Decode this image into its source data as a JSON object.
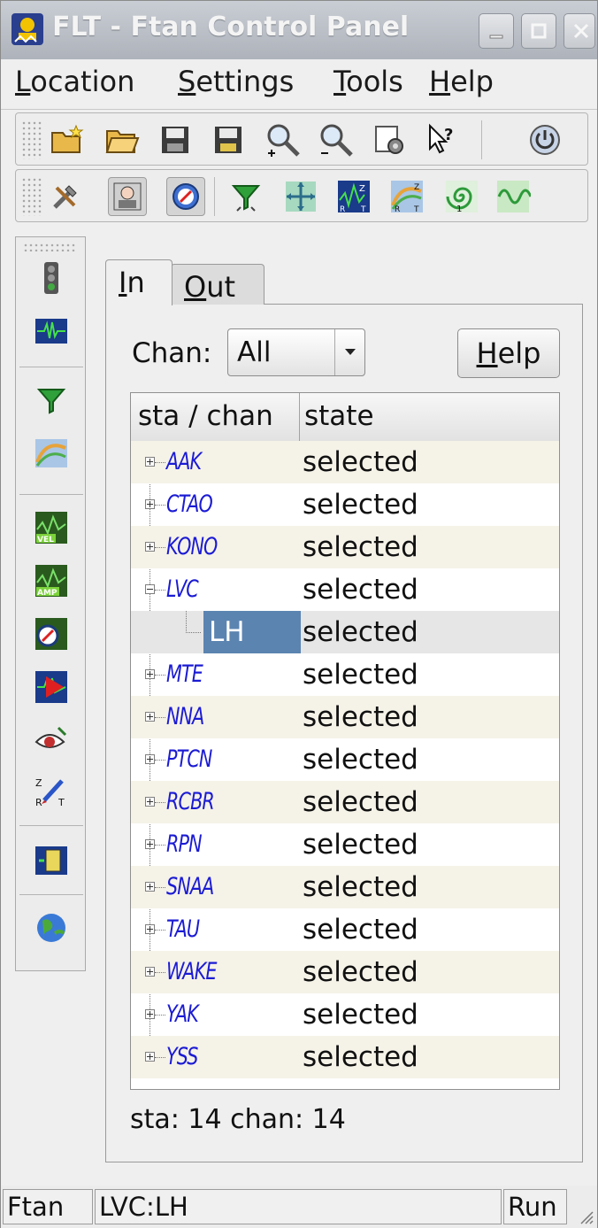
{
  "window": {
    "title": "FLT - Ftan Control Panel"
  },
  "menubar": {
    "items": [
      {
        "label": "Location",
        "mnemonic": "L"
      },
      {
        "label": "Settings",
        "mnemonic": "S"
      },
      {
        "label": "Tools",
        "mnemonic": "T"
      },
      {
        "label": "Help",
        "mnemonic": "H"
      }
    ]
  },
  "toolbar1": {
    "icons": [
      "new-folder-icon",
      "open-folder-icon",
      "save-icon",
      "save-as-icon",
      "zoom-in-icon",
      "zoom-out-icon",
      "settings-gear-icon",
      "whats-this-icon",
      "power-icon"
    ]
  },
  "toolbar2": {
    "icons": [
      "tools-icon",
      "operator-icon",
      "compass-icon",
      "filter-icon",
      "move-cross-icon",
      "seismogram-zrt-icon",
      "curve-rt-icon",
      "spiral-icon",
      "sine-wave-icon"
    ],
    "pressed": [
      "operator-icon",
      "compass-icon"
    ]
  },
  "sidebar": {
    "icons": [
      "traffic-light-icon",
      "waveform-icon",
      "filter-icon",
      "curve-icon",
      "velocity-icon",
      "amplitude-icon",
      "compass-icon",
      "phase-red-icon",
      "eye-icon",
      "zrt-pen-icon",
      "battery-icon",
      "globe-icon"
    ]
  },
  "tabs": [
    {
      "label": "In",
      "mnemonic": "I",
      "active": true
    },
    {
      "label": "Out",
      "mnemonic": "O",
      "active": false
    }
  ],
  "controls": {
    "chan_label": "Chan:",
    "chan_value": "All",
    "help_button": "Help"
  },
  "table": {
    "headers": [
      "sta / chan",
      "state"
    ],
    "rows": [
      {
        "sta": "AAK",
        "state": "selected",
        "expanded": false
      },
      {
        "sta": "CTAO",
        "state": "selected",
        "expanded": false
      },
      {
        "sta": "KONO",
        "state": "selected",
        "expanded": false
      },
      {
        "sta": "LVC",
        "state": "selected",
        "expanded": true
      },
      {
        "sta": "LH",
        "state": "selected",
        "child": true,
        "selected": true
      },
      {
        "sta": "MTE",
        "state": "selected",
        "expanded": false
      },
      {
        "sta": "NNA",
        "state": "selected",
        "expanded": false
      },
      {
        "sta": "PTCN",
        "state": "selected",
        "expanded": false
      },
      {
        "sta": "RCBR",
        "state": "selected",
        "expanded": false
      },
      {
        "sta": "RPN",
        "state": "selected",
        "expanded": false
      },
      {
        "sta": "SNAA",
        "state": "selected",
        "expanded": false
      },
      {
        "sta": "TAU",
        "state": "selected",
        "expanded": false
      },
      {
        "sta": "WAKE",
        "state": "selected",
        "expanded": false
      },
      {
        "sta": "YAK",
        "state": "selected",
        "expanded": false
      },
      {
        "sta": "YSS",
        "state": "selected",
        "expanded": false
      }
    ]
  },
  "summary": "sta: 14 chan: 14",
  "statusbar": {
    "left": "Ftan",
    "middle": "LVC:LH",
    "right": "Run"
  },
  "colors": {
    "selection": "#5b84b1",
    "station_text": "#1b1bd4",
    "alt_row": "#f5f2e8"
  }
}
